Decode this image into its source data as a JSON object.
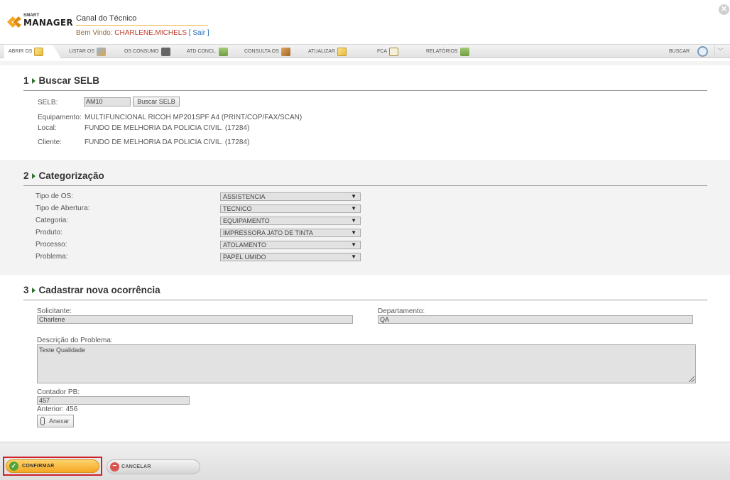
{
  "header": {
    "logo_small": "SMART",
    "logo_main": "MANAGER",
    "app_title": "Canal do Técnico",
    "welcome_label": "Bem Vindo:",
    "user_name": "CHARLENE.MICHELS",
    "logout_label": "[ Sair ]",
    "close_glyph": "✕"
  },
  "toolbar": {
    "items": [
      {
        "label": "ABRIR OS",
        "icon": "note-icon"
      },
      {
        "label": "LISTAR OS",
        "icon": "tools-icon"
      },
      {
        "label": "OS CONSUMO",
        "icon": "gear-icon"
      },
      {
        "label": "ATD CONCL.",
        "icon": "table-icon"
      },
      {
        "label": "CONSULTA OS",
        "icon": "box-icon"
      },
      {
        "label": "ATUALIZAR",
        "icon": "note-icon"
      },
      {
        "label": "FCA",
        "icon": "clipboard-icon"
      },
      {
        "label": "RELATÓRIOS",
        "icon": "table-icon"
      }
    ],
    "search_label": "BUSCAR",
    "chevron_glyph": "﹀"
  },
  "section1": {
    "number": "1",
    "title": "Buscar SELB",
    "selb_label": "SELB:",
    "selb_value": "AM10",
    "search_button": "Buscar SELB",
    "equipment_label": "Equipamento:",
    "equipment_value": "MULTIFUNCIONAL RICOH MP201SPF A4 (PRINT/COP/FAX/SCAN)",
    "location_label": "Local:",
    "location_value": "FUNDO DE MELHORIA DA POLICIA CIVIL. (17284)",
    "client_label": "Cliente:",
    "client_value": "FUNDO DE MELHORIA DA POLICIA CIVIL. (17284)"
  },
  "section2": {
    "number": "2",
    "title": "Categorização",
    "fields": [
      {
        "label": "Tipo de OS:",
        "value": "ASSISTENCIA"
      },
      {
        "label": "Tipo de Abertura:",
        "value": "TECNICO"
      },
      {
        "label": "Categoria:",
        "value": "EQUIPAMENTO"
      },
      {
        "label": "Produto:",
        "value": "IMPRESSORA JATO DE TINTA"
      },
      {
        "label": "Processo:",
        "value": "ATOLAMENTO"
      },
      {
        "label": "Problema:",
        "value": "PAPEL UMIDO"
      }
    ],
    "arrow_glyph": "▼"
  },
  "section3": {
    "number": "3",
    "title": "Cadastrar nova ocorrência",
    "requester_label": "Solicitante:",
    "requester_value": "Charlene",
    "department_label": "Departamento:",
    "department_value": "QA",
    "description_label": "Descrição do Problema:",
    "description_value": "Teste Qualidade",
    "counter_label": "Contador PB:",
    "counter_value": "457",
    "previous_label": "Anterior: 456",
    "attach_button": "Anexar"
  },
  "footer": {
    "confirm_label": "CONFIRMAR",
    "cancel_label": "CANCELAR",
    "confirm_glyph": "✓",
    "cancel_glyph": "−"
  },
  "colors": {
    "accent_orange": "#f5a623",
    "section_title_arrow": "#2f6f2f",
    "highlight_red": "#d0202a"
  }
}
